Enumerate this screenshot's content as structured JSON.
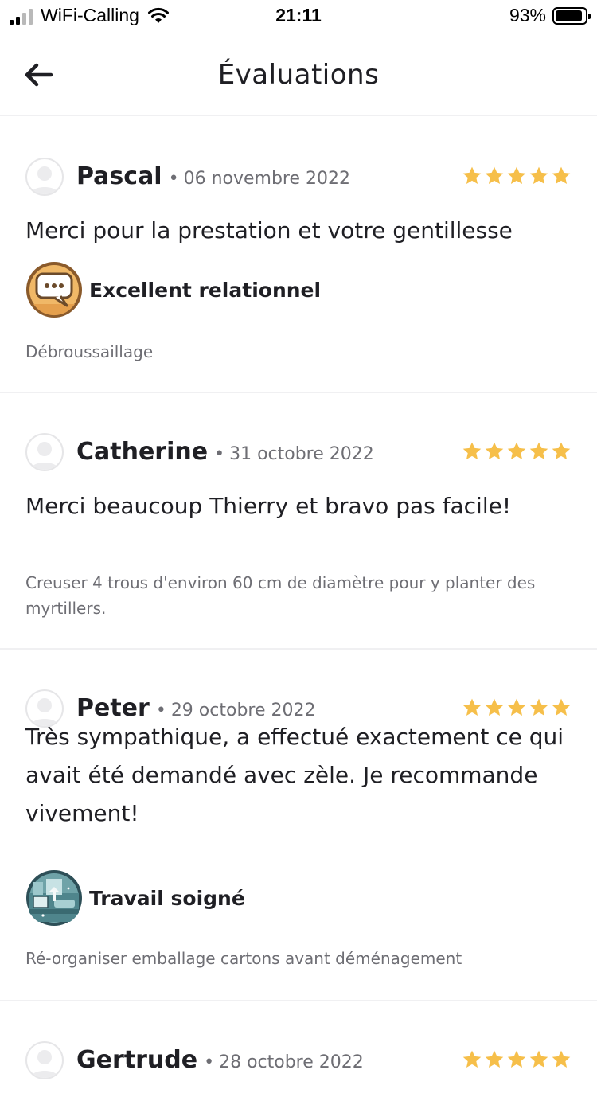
{
  "status_bar": {
    "carrier": "WiFi-Calling",
    "time": "21:11",
    "battery_percent": "93%",
    "battery_level": 0.93,
    "signal_bars_active": 2
  },
  "nav": {
    "back_icon": "arrow-left-icon",
    "title": "Évaluations"
  },
  "colors": {
    "star": "#f6bf4a",
    "divider": "#f0f0f2",
    "secondary_text": "#6e6e74"
  },
  "reviews": [
    {
      "name": "Pascal",
      "separator": "•",
      "date": "06 novembre 2022",
      "rating": 5,
      "comment": "Merci pour la prestation et votre gentillesse",
      "badge": {
        "icon": "speech-bubble-icon",
        "label": "Excellent relationnel"
      },
      "task": "Débroussaillage"
    },
    {
      "name": "Catherine",
      "separator": "•",
      "date": "31 octobre 2022",
      "rating": 5,
      "comment": "Merci beaucoup Thierry et bravo pas facile!",
      "task": "Creuser 4 trous d'environ 60 cm de diamètre pour y planter des myrtillers."
    },
    {
      "name": "Peter",
      "separator": "•",
      "date": "29 octobre 2022",
      "rating": 5,
      "comment": "Très sympathique, a effectué exactement ce qui avait été demandé avec zèle. Je recommande vivement!",
      "badge": {
        "icon": "clean-room-icon",
        "label": "Travail soigné"
      },
      "task": "Ré-organiser emballage cartons avant déménagement"
    },
    {
      "name": "Gertrude",
      "separator": "•",
      "date": "28 octobre 2022",
      "rating": 5
    }
  ]
}
